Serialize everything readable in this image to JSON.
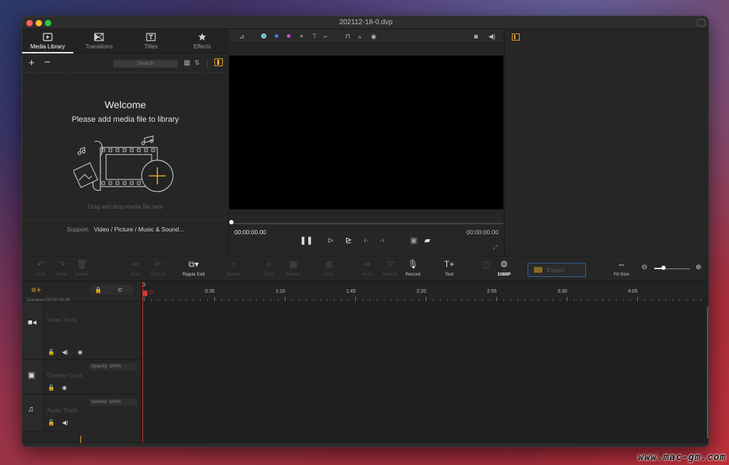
{
  "window": {
    "title": "202112-18-0.dvp"
  },
  "left_tabs": [
    {
      "label": "Media Library",
      "icon": "media-library-icon",
      "active": true
    },
    {
      "label": "Transitions",
      "icon": "transitions-icon",
      "active": false
    },
    {
      "label": "Titles",
      "icon": "titles-icon",
      "active": false
    },
    {
      "label": "Effects",
      "icon": "effects-icon",
      "active": false
    }
  ],
  "library": {
    "search_placeholder": "Search",
    "welcome_title": "Welcome",
    "welcome_subtitle": "Please add media file to library",
    "drag_hint": "Drag and drop media file here",
    "support_label": "Support:",
    "support_value": "Video / Picture / Music & Sound..."
  },
  "preview": {
    "time_current": "00:00:00.00",
    "time_total": "00:00:00.00"
  },
  "toolbar": {
    "undo": "Undo",
    "redo": "Redo",
    "delete": "Delete",
    "split": "Split",
    "split_all": "Split All",
    "ripple_edit": "Ripple Edit",
    "speed": "Speed",
    "crop": "Crop",
    "mosaic": "Mosaic",
    "color": "Color",
    "audio": "Audio",
    "detach": "Detach",
    "record": "Record",
    "text": "Text",
    "resolution": "1080P",
    "export": "Export",
    "fit_size": "Fit Size"
  },
  "timeline": {
    "duration": "Duration:00:00:00.00",
    "playhead_label": "0",
    "ticks": [
      "0:35",
      "1:10",
      "1:45",
      "2:20",
      "2:55",
      "3:30",
      "4:05"
    ],
    "tracks": {
      "video": {
        "name": "Video Track"
      },
      "overlay": {
        "name": "Overlay Track",
        "field": "Opacity: 100%"
      },
      "audio": {
        "name": "Audio Track",
        "field": "Volume: 100%"
      }
    }
  },
  "watermark": "www.mac-gm.com",
  "colors": {
    "accent": "#e0a030",
    "playhead": "#d03a3a",
    "export_border": "#2f5f9a",
    "window_bg": "#232323"
  }
}
